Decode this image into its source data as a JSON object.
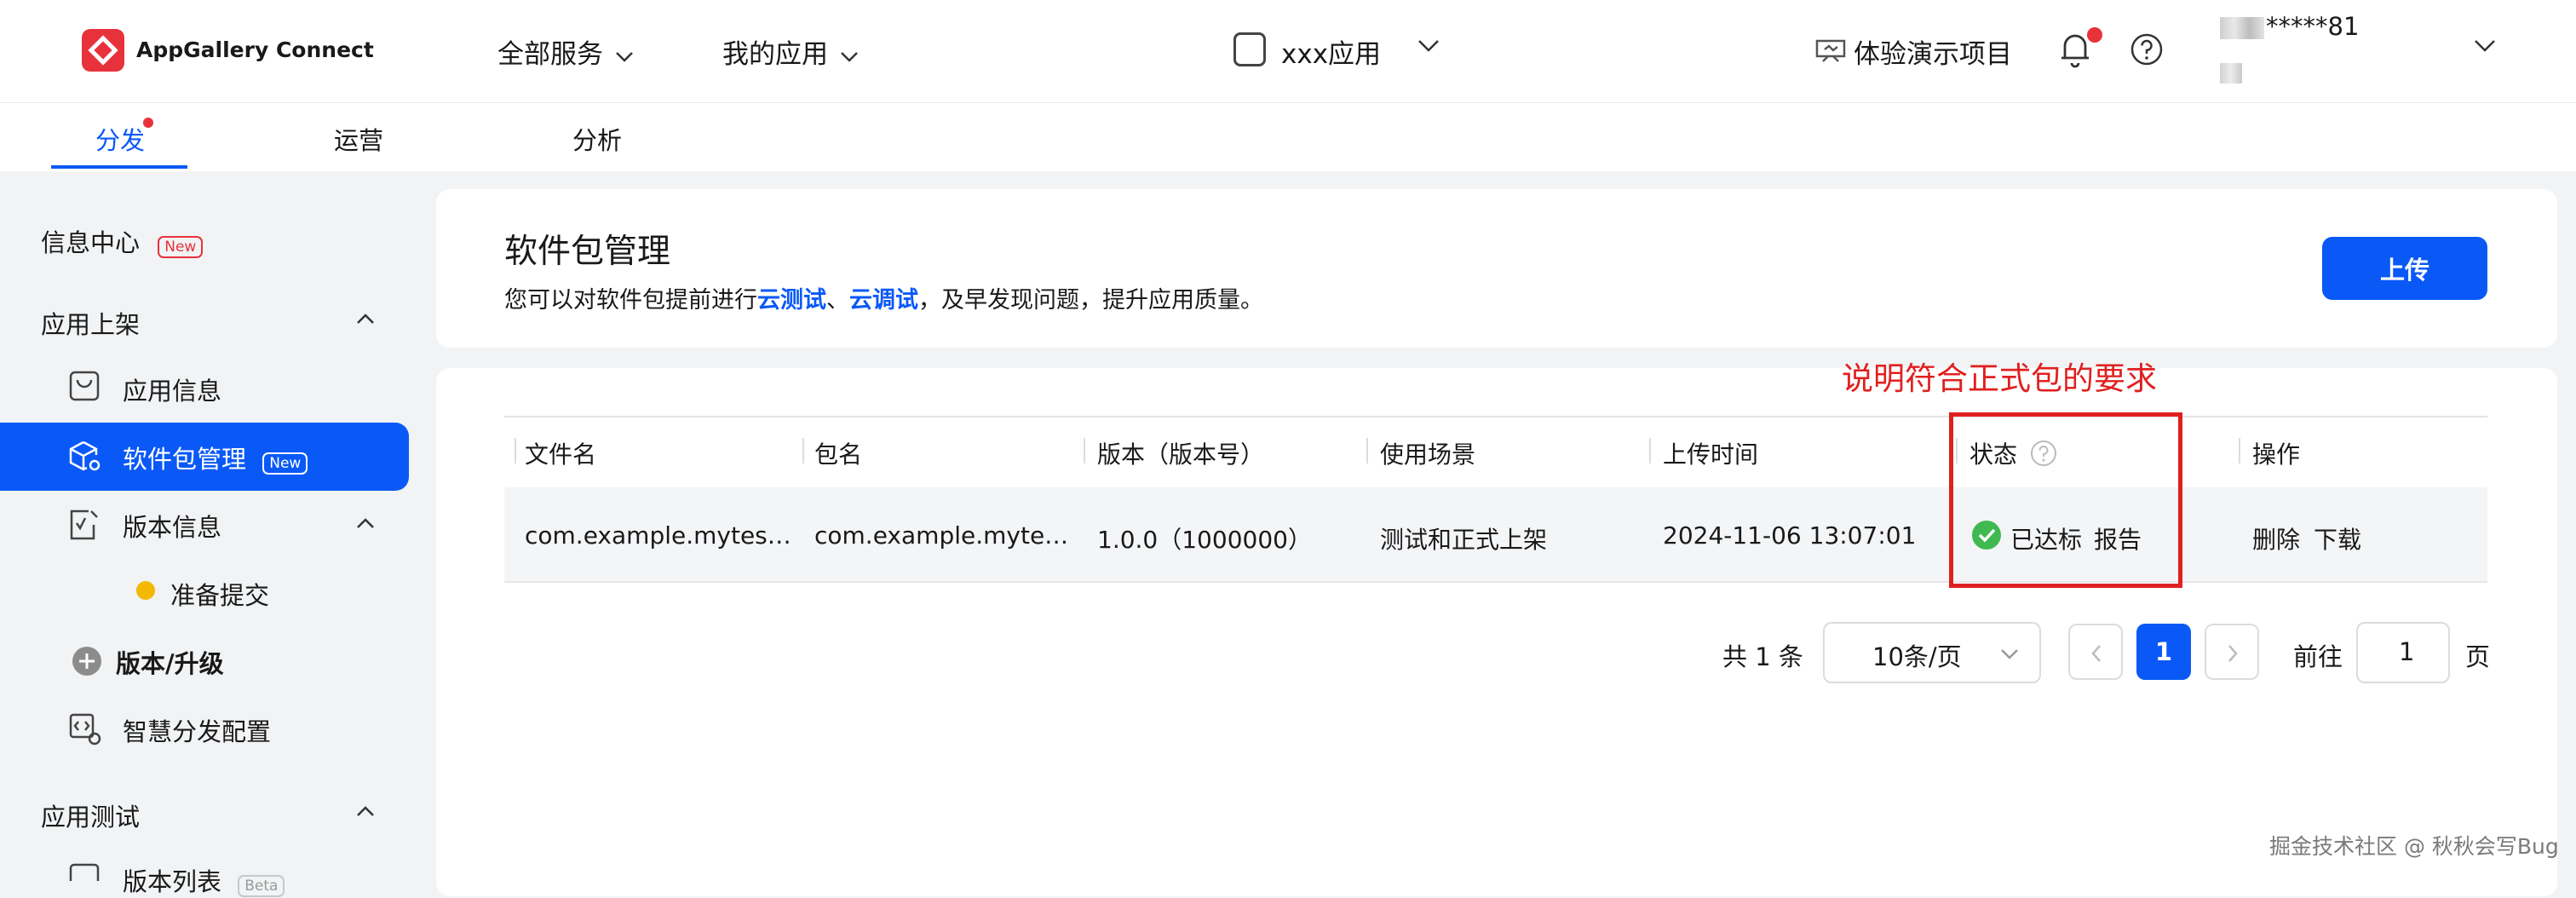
{
  "header": {
    "brand": "AppGallery Connect",
    "nav": [
      "全部服务",
      "我的应用"
    ],
    "app_name": "xxx应用",
    "demo_label": "体验演示项目",
    "user_masked": "*****81"
  },
  "tabs": [
    "分发",
    "运营",
    "分析"
  ],
  "sidebar": {
    "info_center": "信息中心",
    "badge_new": "New",
    "group_release": "应用上架",
    "items": [
      "应用信息",
      "软件包管理",
      "版本信息"
    ],
    "sub_item": "准备提交",
    "version_upgrade": "版本/升级",
    "smart_distribution": "智慧分发配置",
    "group_testing": "应用测试",
    "version_list": "版本列表",
    "badge_beta": "Beta"
  },
  "main": {
    "title": "软件包管理",
    "desc_prefix": "您可以对软件包提前进行",
    "desc_link1": "云测试",
    "desc_sep": "、",
    "desc_link2": "云调试",
    "desc_suffix": "，及早发现问题，提升应用质量。",
    "upload_label": "上传",
    "annotation": "说明符合正式包的要求"
  },
  "table": {
    "headers": [
      "文件名",
      "包名",
      "版本（版本号）",
      "使用场景",
      "上传时间",
      "状态",
      "操作"
    ],
    "rows": [
      {
        "file_name": "com.example.mytes…",
        "package_name": "com.example.myte…",
        "version": "1.0.0（1000000）",
        "scenario": "测试和正式上架",
        "upload_time": "2024-11-06 13:07:01",
        "status": "已达标",
        "report_link": "报告",
        "actions": [
          "删除",
          "下载"
        ]
      }
    ]
  },
  "pagination": {
    "total": "共 1 条",
    "page_size": "10条/页",
    "current_page": "1",
    "goto_prefix": "前往",
    "goto_value": "1",
    "goto_suffix": "页"
  },
  "watermark": "掘金技术社区 @ 秋秋会写Bug",
  "colors": {
    "accent": "#0a59f7",
    "brand": "#e8323b",
    "success": "#3fb950",
    "annotation": "#e02020"
  }
}
